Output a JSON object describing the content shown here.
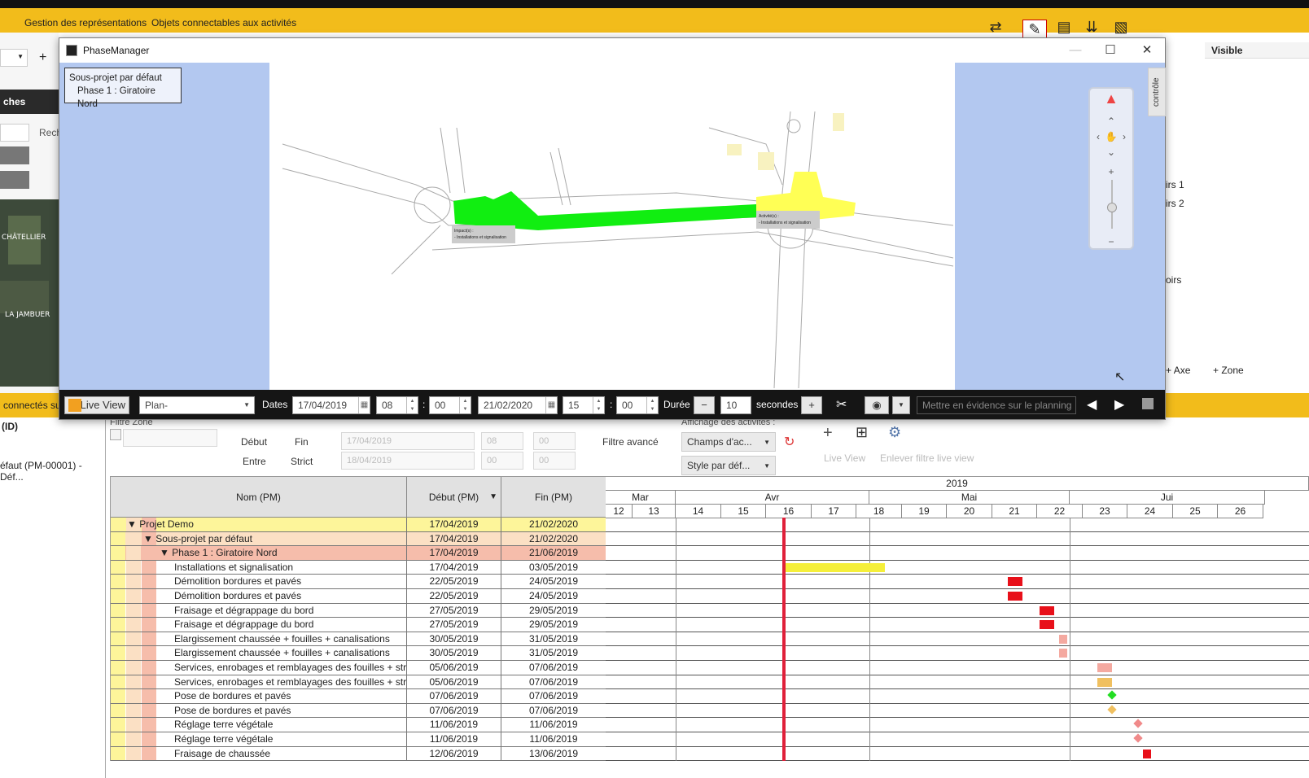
{
  "app": {
    "menu": [
      "Gestion des représentations",
      "Objets connectables aux activités"
    ],
    "visible_header": "Visible",
    "behind_labels": [
      "irs 1",
      "irs 2",
      "oirs"
    ],
    "axe_button": "Axe",
    "zone_button": "Zone",
    "left_labels": {
      "strip": "ches",
      "search": "Rech",
      "connected": "connectés sur",
      "id_col": "(ID)",
      "default_item": "éfaut (PM-00001) - Déf..."
    },
    "map_labels": [
      "CHÂTELLIER",
      "LA JAMBUER"
    ]
  },
  "phasemanager": {
    "title": "PhaseManager",
    "phase_box": {
      "line1": "Sous-projet par défaut",
      "line2": "Phase 1 : Giratoire Nord"
    },
    "map_labels": {
      "a": "Impact(s) :",
      "b": "- Installations et signalisation",
      "c": "Activité(s) :",
      "d": "- Installations et signalisation"
    },
    "control_tab": "contrôle",
    "toolbar": {
      "live_view": "Live View",
      "plan": "Plan-",
      "dates_label": "Dates",
      "date_start": "17/04/2019",
      "hour_start": "08",
      "min_start": "00",
      "date_end": "21/02/2020",
      "hour_end": "15",
      "min_end": "00",
      "duree_label": "Durée",
      "duree_value": "10",
      "duree_unit": "secondes",
      "highlight_placeholder": "Mettre en évidence sur le planning"
    }
  },
  "filters": {
    "filtre_zone": "Filtre Zone",
    "debut": "Début",
    "fin": "Fin",
    "entre": "Entre",
    "strict": "Strict",
    "d1": "17/04/2019",
    "d2": "18/04/2019",
    "h1": "08",
    "h2": "00",
    "m1": "00",
    "m2": "00",
    "filtre_avance": "Filtre avancé",
    "affichage": "Affichage des activités :",
    "champs": "Champs d'ac...",
    "style": "Style par déf...",
    "live_view": "Live View",
    "enlever": "Enlever filtre live view"
  },
  "grid": {
    "headers": {
      "name": "Nom (PM)",
      "start": "Début (PM)",
      "end": "Fin (PM)"
    },
    "rows": [
      {
        "name": "Projet Demo",
        "start": "17/04/2019",
        "end": "21/02/2020",
        "level": 0
      },
      {
        "name": "Sous-projet par défaut",
        "start": "17/04/2019",
        "end": "21/02/2020",
        "level": 1
      },
      {
        "name": "Phase 1 : Giratoire Nord",
        "start": "17/04/2019",
        "end": "21/06/2019",
        "level": 2
      },
      {
        "name": "Installations et signalisation",
        "start": "17/04/2019",
        "end": "03/05/2019",
        "level": 3
      },
      {
        "name": "Démolition bordures et pavés",
        "start": "22/05/2019",
        "end": "24/05/2019",
        "level": 3
      },
      {
        "name": "Démolition bordures et pavés",
        "start": "22/05/2019",
        "end": "24/05/2019",
        "level": 3
      },
      {
        "name": "Fraisage et dégrappage du bord",
        "start": "27/05/2019",
        "end": "29/05/2019",
        "level": 3
      },
      {
        "name": "Fraisage et dégrappage du bord",
        "start": "27/05/2019",
        "end": "29/05/2019",
        "level": 3
      },
      {
        "name": "Elargissement chaussée + fouilles + canalisations",
        "start": "30/05/2019",
        "end": "31/05/2019",
        "level": 3
      },
      {
        "name": "Elargissement chaussée + fouilles + canalisations",
        "start": "30/05/2019",
        "end": "31/05/2019",
        "level": 3
      },
      {
        "name": "Services, enrobages et remblayages des fouilles + str...",
        "start": "05/06/2019",
        "end": "07/06/2019",
        "level": 3
      },
      {
        "name": "Services, enrobages et remblayages des fouilles + str...",
        "start": "05/06/2019",
        "end": "07/06/2019",
        "level": 3
      },
      {
        "name": "Pose de bordures et pavés",
        "start": "07/06/2019",
        "end": "07/06/2019",
        "level": 3
      },
      {
        "name": "Pose de bordures et pavés",
        "start": "07/06/2019",
        "end": "07/06/2019",
        "level": 3
      },
      {
        "name": "Réglage terre végétale",
        "start": "11/06/2019",
        "end": "11/06/2019",
        "level": 3
      },
      {
        "name": "Réglage terre végétale",
        "start": "11/06/2019",
        "end": "11/06/2019",
        "level": 3
      },
      {
        "name": "Fraisage de chaussée",
        "start": "12/06/2019",
        "end": "13/06/2019",
        "level": 3
      }
    ]
  },
  "gantt": {
    "year": "2019",
    "months": [
      "Mar",
      "Avr",
      "Mai",
      "Jui"
    ],
    "weeks": [
      "12",
      "13",
      "14",
      "15",
      "16",
      "17",
      "18",
      "19",
      "20",
      "21",
      "22",
      "23",
      "24",
      "25",
      "26"
    ],
    "bars": [
      {
        "row": 3,
        "color": "#f5ef3a",
        "kind": "bar"
      },
      {
        "row": 4,
        "color": "#e8101a",
        "kind": "bar"
      },
      {
        "row": 5,
        "color": "#e8101a",
        "kind": "bar"
      },
      {
        "row": 6,
        "color": "#e8101a",
        "kind": "bar"
      },
      {
        "row": 7,
        "color": "#e8101a",
        "kind": "bar"
      },
      {
        "row": 8,
        "color": "#f4a9a0",
        "kind": "bar"
      },
      {
        "row": 9,
        "color": "#f4a9a0",
        "kind": "bar"
      },
      {
        "row": 10,
        "color": "#f4a9a0",
        "kind": "bar"
      },
      {
        "row": 11,
        "color": "#f0c060",
        "kind": "bar"
      },
      {
        "row": 12,
        "color": "#22dd22",
        "kind": "diamond"
      },
      {
        "row": 13,
        "color": "#f0c060",
        "kind": "diamond"
      },
      {
        "row": 14,
        "color": "#f08a8a",
        "kind": "diamond"
      },
      {
        "row": 15,
        "color": "#f08a8a",
        "kind": "diamond"
      },
      {
        "row": 16,
        "color": "#e8101a",
        "kind": "bar"
      }
    ]
  }
}
